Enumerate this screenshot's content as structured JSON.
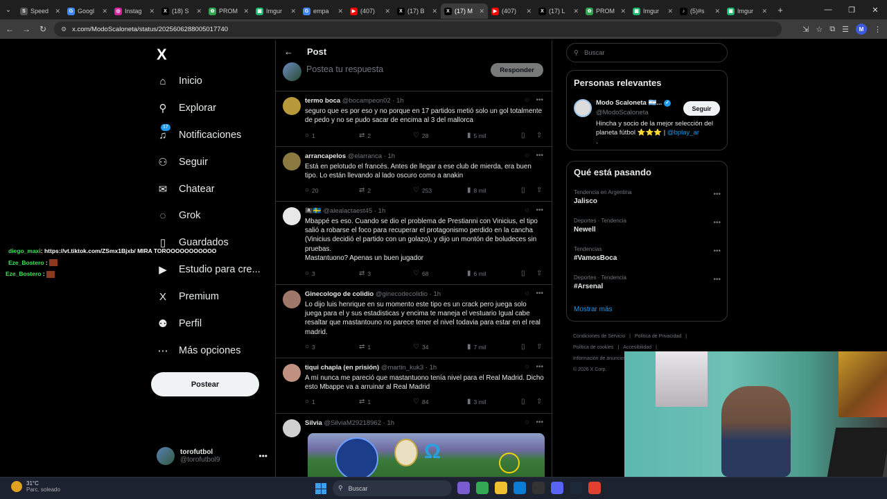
{
  "browser": {
    "tabs": [
      {
        "title": "Speed",
        "icon_color": "#555555",
        "icon": "S"
      },
      {
        "title": "Googl",
        "icon_color": "#4285f4",
        "icon": "G"
      },
      {
        "title": "Instag",
        "icon_color": "#d6249f",
        "icon": "◎"
      },
      {
        "title": "(18) S",
        "icon_color": "#000000",
        "icon": "X"
      },
      {
        "title": "PROM",
        "icon_color": "#2ea44f",
        "icon": "✿"
      },
      {
        "title": "Imgur",
        "icon_color": "#1bb76e",
        "icon": "▣"
      },
      {
        "title": "empa",
        "icon_color": "#4285f4",
        "icon": "G"
      },
      {
        "title": "(407)",
        "icon_color": "#ff0000",
        "icon": "▶"
      },
      {
        "title": "(17) B",
        "icon_color": "#000000",
        "icon": "X"
      },
      {
        "title": "(17) M",
        "icon_color": "#000000",
        "icon": "X",
        "active": true
      },
      {
        "title": "(407)",
        "icon_color": "#ff0000",
        "icon": "▶"
      },
      {
        "title": "(17) L",
        "icon_color": "#000000",
        "icon": "X"
      },
      {
        "title": "PROM",
        "icon_color": "#2ea44f",
        "icon": "✿"
      },
      {
        "title": "Imgur",
        "icon_color": "#1bb76e",
        "icon": "▣"
      },
      {
        "title": "(5)#s",
        "icon_color": "#000000",
        "icon": "♪"
      },
      {
        "title": "Imgur",
        "icon_color": "#1bb76e",
        "icon": "▣"
      }
    ],
    "url": "x.com/ModoScaloneta/status/2025606288005017740",
    "profile_initial": "M"
  },
  "nav": {
    "logo": "X",
    "items": [
      {
        "label": "Inicio",
        "icon": "home-icon",
        "glyph": "⌂"
      },
      {
        "label": "Explorar",
        "icon": "search-icon",
        "glyph": "⚲"
      },
      {
        "label": "Notificaciones",
        "icon": "bell-icon",
        "glyph": "♫",
        "badge": "17"
      },
      {
        "label": "Seguir",
        "icon": "add-person-icon",
        "glyph": "⚇"
      },
      {
        "label": "Chatear",
        "icon": "envelope-icon",
        "glyph": "✉"
      },
      {
        "label": "Grok",
        "icon": "grok-icon",
        "glyph": "◌"
      },
      {
        "label": "Guardados",
        "icon": "bookmark-icon",
        "glyph": "▯"
      },
      {
        "label": "Estudio para cre...",
        "icon": "studio-icon",
        "glyph": "▶"
      },
      {
        "label": "Premium",
        "icon": "premium-x-icon",
        "glyph": "X"
      },
      {
        "label": "Perfil",
        "icon": "person-icon",
        "glyph": "⚉"
      },
      {
        "label": "Más opciones",
        "icon": "more-circle-icon",
        "glyph": "⋯"
      }
    ],
    "post_button": "Postear",
    "account": {
      "name": "torofutbol",
      "handle": "@torofutbol9"
    }
  },
  "chat_overlay": [
    {
      "user": "diego_maxi",
      "message": ": https://vt.tiktok.com/ZSmx1Bjxb/ MIRA TOROOOOOOOOOOO"
    },
    {
      "user": "Eze_Bostero",
      "message": " :"
    },
    {
      "user": "Eze_Bostero",
      "message": " :"
    }
  ],
  "center": {
    "title": "Post",
    "reply_placeholder": "Postea tu respuesta",
    "reply_button": "Responder",
    "tweets": [
      {
        "name": "termo boca",
        "handle": "@bocampeon02",
        "time": "· 1h",
        "text": "seguro que es por eso y no porque en 17 partidos metió solo un gol totalmente de pedo y no se pudo sacar de encima al 3 del mallorca",
        "replies": "1",
        "reposts": "2",
        "likes": "28",
        "views": "5 mil",
        "avatar_color": "#b89a3a"
      },
      {
        "name": "arrancapelos",
        "handle": "@elarranca",
        "time": "· 1h",
        "text": "Está en pelotudo el francés. Antes de llegar a ese club de mierda, era buen tipo. Lo están llevando al lado oscuro como a anakin",
        "replies": "20",
        "reposts": "2",
        "likes": "253",
        "views": "8 mil",
        "avatar_color": "#8a7a40"
      },
      {
        "name": "🏴‍☠️🇸🇪",
        "handle": "@alealactaest45",
        "time": "· 1h",
        "text": "Mbappé es eso. Cuando se dio el problema de Prestianni con Vinicius, el tipo salió a robarse el foco para recuperar el protagonismo perdido en la cancha (Vinicius decidió el partido con un golazo), y dijo un montón de boludeces sin pruebas.\nMastantuono? Apenas un buen jugador",
        "replies": "3",
        "reposts": "3",
        "likes": "68",
        "views": "6 mil",
        "avatar_color": "#e8e8e8"
      },
      {
        "name": "Ginecologo de colidio",
        "handle": "@ginecodecolidio",
        "time": "· 1h",
        "text": "Lo dijo luis henrique en su momento este tipo es un crack pero juega solo juega para el y sus estadisticas y encima te maneja el vestuario Igual cabe resaltar que mastantouno no parece tener el nivel todavia para estar en el real madrid.",
        "replies": "3",
        "reposts": "1",
        "likes": "34",
        "views": "7 mil",
        "avatar_color": "#a0786a"
      },
      {
        "name": "tiqui chapla (en prisión)",
        "handle": "@martin_kuk3",
        "time": "· 1h",
        "text": "A mí nunca me pareció que mastantuono tenía nivel para el Real Madrid. Dicho esto Mbappe va a arruinar al Real Madrid",
        "replies": "1",
        "reposts": "1",
        "likes": "84",
        "views": "3 mil",
        "avatar_color": "#c09080"
      },
      {
        "name": "Silvia",
        "handle": "@SilviaM29218962",
        "time": "· 1h",
        "text": "",
        "avatar_color": "#d0d0d0"
      }
    ]
  },
  "right": {
    "search_placeholder": "Buscar",
    "relevant_title": "Personas relevantes",
    "relevant": {
      "name": "Modo Scaloneta 🇦🇷...",
      "handle": "@ModoScaloneta",
      "follow": "Seguir",
      "bio": "Hincha y socio de la mejor selección del planeta fútbol ⭐⭐⭐ | ",
      "bio_link": "@bplay_ar",
      "bio_tail": "."
    },
    "trending_title": "Qué está pasando",
    "trends": [
      {
        "category": "Tendencia en Argentina",
        "name": "Jalisco"
      },
      {
        "category": "Deportes · Tendencia",
        "name": "Newell"
      },
      {
        "category": "Tendencias",
        "name": "#VamosBoca"
      },
      {
        "category": "Deportes · Tendencia",
        "name": "#Arsenal"
      }
    ],
    "show_more": "Mostrar más",
    "footer": [
      "Condiciones de Servicio",
      "|",
      "Política de Privacidad",
      "|",
      "Política de cookies",
      "|",
      "Accesibilidad",
      "|",
      "Información de anuncios",
      "© 2026 X Corp."
    ]
  },
  "taskbar": {
    "temp": "31°C",
    "weather": "Parc. soleado",
    "search": "Buscar"
  }
}
